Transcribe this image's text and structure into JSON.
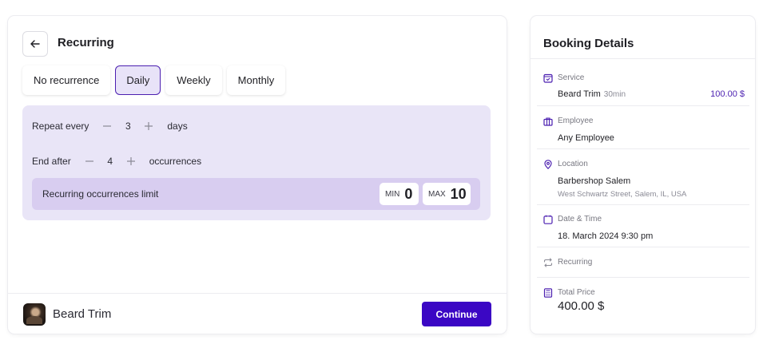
{
  "main": {
    "title": "Recurring",
    "tabs": [
      {
        "label": "No recurrence"
      },
      {
        "label": "Daily",
        "active": true
      },
      {
        "label": "Weekly"
      },
      {
        "label": "Monthly"
      }
    ],
    "repeat": {
      "label": "Repeat every",
      "value": "3",
      "unit": "days"
    },
    "end": {
      "label": "End after",
      "value": "4",
      "unit": "occurrences"
    },
    "limit": {
      "label": "Recurring occurrences limit",
      "min_label": "MIN",
      "min_value": "0",
      "max_label": "MAX",
      "max_value": "10"
    }
  },
  "footer": {
    "service_name": "Beard Trim",
    "continue_label": "Continue"
  },
  "details": {
    "title": "Booking Details",
    "service": {
      "label": "Service",
      "name": "Beard Trim",
      "duration": "30min",
      "price": "100.00 $"
    },
    "employee": {
      "label": "Employee",
      "value": "Any Employee"
    },
    "location": {
      "label": "Location",
      "name": "Barbershop Salem",
      "address": "West Schwartz Street, Salem, IL, USA"
    },
    "datetime": {
      "label": "Date & Time",
      "value": "18. March 2024  9:30 pm"
    },
    "recurring": {
      "label": "Recurring"
    },
    "total": {
      "label": "Total Price",
      "value": "400.00 $"
    }
  },
  "colors": {
    "accent": "#3b07c4",
    "panel": "#e9e5f7",
    "limit_bar": "#d8cdf0",
    "icon": "#4b1fb0"
  },
  "icons": [
    "arrow-left-icon",
    "minus-icon",
    "plus-icon",
    "calendar-check-icon",
    "briefcase-icon",
    "map-pin-icon",
    "calendar-icon",
    "repeat-icon",
    "calculator-icon"
  ]
}
